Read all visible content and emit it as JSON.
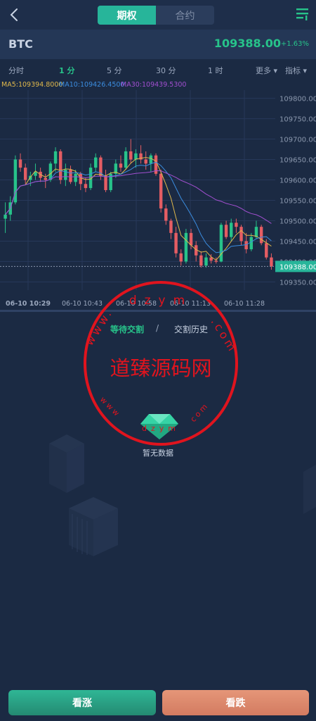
{
  "header": {
    "tabs": [
      "期权",
      "合约"
    ],
    "active_tab": 0
  },
  "ticker": {
    "symbol": "BTC",
    "price": "109388.00",
    "change": "+1.63%"
  },
  "intervals": {
    "items": [
      "分时",
      "1 分",
      "5 分",
      "30 分",
      "1 时"
    ],
    "selected": 1,
    "more": "更多 ▾",
    "indicator": "指标 ▾"
  },
  "ma": {
    "ma5": "MA5:109394.8000",
    "ma10": "MA10:109426.4500",
    "ma30": "MA30:109439.5300"
  },
  "colors": {
    "up": "#27c38a",
    "down": "#e55d63",
    "ma5": "#e0b84b",
    "ma10": "#3b8de0",
    "ma30": "#a24fd0",
    "accent": "#27b59a"
  },
  "chart_data": {
    "type": "candlestick",
    "y_ticks": [
      "109800.00",
      "109750.00",
      "109700.00",
      "109650.00",
      "109600.00",
      "109550.00",
      "109500.00",
      "109450.00",
      "109400.00",
      "109350.00"
    ],
    "ylim": [
      109330,
      109820
    ],
    "x_ticks": [
      "06-10 10:29",
      "06-10 10:43",
      "06-10 10:58",
      "06-10 11:13",
      "06-10 11:28"
    ],
    "current_price": "109388.00",
    "candles": [
      [
        109505,
        109545,
        109470,
        109515
      ],
      [
        109515,
        109560,
        109500,
        109545
      ],
      [
        109545,
        109660,
        109540,
        109650
      ],
      [
        109650,
        109665,
        109620,
        109630
      ],
      [
        109630,
        109640,
        109590,
        109600
      ],
      [
        109600,
        109620,
        109585,
        109610
      ],
      [
        109610,
        109640,
        109600,
        109620
      ],
      [
        109620,
        109630,
        109595,
        109605
      ],
      [
        109605,
        109615,
        109580,
        109600
      ],
      [
        109600,
        109645,
        109595,
        109640
      ],
      [
        109640,
        109680,
        109620,
        109670
      ],
      [
        109670,
        109675,
        109590,
        109600
      ],
      [
        109600,
        109640,
        109585,
        109625
      ],
      [
        109625,
        109635,
        109590,
        109595
      ],
      [
        109595,
        109625,
        109585,
        109615
      ],
      [
        109615,
        109620,
        109575,
        109590
      ],
      [
        109590,
        109605,
        109570,
        109580
      ],
      [
        109580,
        109640,
        109575,
        109630
      ],
      [
        109630,
        109665,
        109620,
        109655
      ],
      [
        109655,
        109660,
        109600,
        109610
      ],
      [
        109610,
        109625,
        109570,
        109575
      ],
      [
        109575,
        109620,
        109570,
        109615
      ],
      [
        109615,
        109650,
        109605,
        109640
      ],
      [
        109640,
        109660,
        109620,
        109630
      ],
      [
        109630,
        109680,
        109625,
        109670
      ],
      [
        109670,
        109700,
        109640,
        109650
      ],
      [
        109650,
        109675,
        109630,
        109665
      ],
      [
        109665,
        109685,
        109640,
        109650
      ],
      [
        109650,
        109670,
        109625,
        109640
      ],
      [
        109640,
        109665,
        109620,
        109660
      ],
      [
        109660,
        109665,
        109610,
        109615
      ],
      [
        109615,
        109625,
        109520,
        109530
      ],
      [
        109530,
        109540,
        109490,
        109500
      ],
      [
        109500,
        109505,
        109455,
        109470
      ],
      [
        109470,
        109485,
        109410,
        109420
      ],
      [
        109420,
        109430,
        109390,
        109400
      ],
      [
        109400,
        109480,
        109395,
        109470
      ],
      [
        109470,
        109480,
        109430,
        109440
      ],
      [
        109440,
        109450,
        109400,
        109415
      ],
      [
        109415,
        109425,
        109385,
        109390
      ],
      [
        109390,
        109420,
        109385,
        109410
      ],
      [
        109410,
        109418,
        109395,
        109402
      ],
      [
        109402,
        109410,
        109395,
        109400
      ],
      [
        109400,
        109495,
        109398,
        109490
      ],
      [
        109490,
        109500,
        109455,
        109460
      ],
      [
        109460,
        109505,
        109450,
        109495
      ],
      [
        109495,
        109505,
        109470,
        109485
      ],
      [
        109485,
        109490,
        109440,
        109450
      ],
      [
        109450,
        109470,
        109420,
        109430
      ],
      [
        109430,
        109470,
        109425,
        109460
      ],
      [
        109460,
        109500,
        109455,
        109485
      ],
      [
        109485,
        109490,
        109440,
        109445
      ],
      [
        109445,
        109455,
        109405,
        109410
      ],
      [
        109410,
        109420,
        109380,
        109388
      ]
    ]
  },
  "orders": {
    "tabs": [
      "等待交割",
      "交割历史"
    ],
    "separator": "/",
    "empty_text": "暂无数据"
  },
  "watermark": {
    "main": "道臻源码网",
    "top": "dzym",
    "left": "www.",
    "right": ".com",
    "bottom_left": "www",
    "bottom": "dzym",
    "bottom_right": "com"
  },
  "actions": {
    "up_label": "看涨",
    "down_label": "看跌"
  }
}
